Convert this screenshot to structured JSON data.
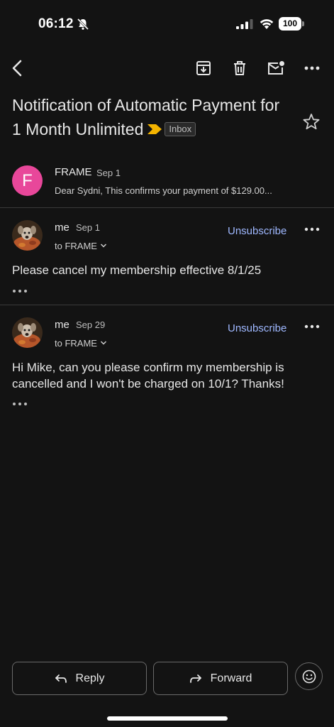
{
  "status_bar": {
    "time": "06:12",
    "battery": "100",
    "icons": [
      "bell-slash-icon",
      "cellular-signal-icon",
      "wifi-icon",
      "battery-icon"
    ]
  },
  "toolbar": {
    "icons": [
      "back-arrow-icon",
      "archive-icon",
      "trash-icon",
      "mark-unread-icon",
      "more-icon"
    ]
  },
  "thread": {
    "subject": "Notification of Automatic Payment for 1 Month Unlimited",
    "label": "Inbox",
    "importance_color": "#f4b400"
  },
  "messages": [
    {
      "sender": "FRAME",
      "date": "Sep 1",
      "avatar_letter": "F",
      "avatar_color": "#e8479a",
      "snippet": "Dear Sydni, This confirms your payment of $129.00..."
    },
    {
      "sender": "me",
      "date": "Sep 1",
      "to": "to FRAME",
      "unsubscribe": "Unsubscribe",
      "body": "Please cancel my membership effective 8/1/25"
    },
    {
      "sender": "me",
      "date": "Sep 29",
      "to": "to FRAME",
      "unsubscribe": "Unsubscribe",
      "body": "Hi Mike, can you please confirm my membership is cancelled and I won't be charged on 10/1? Thanks!"
    }
  ],
  "actions": {
    "reply": "Reply",
    "forward": "Forward"
  },
  "colors": {
    "background": "#131313",
    "link": "#9fb8ff"
  }
}
